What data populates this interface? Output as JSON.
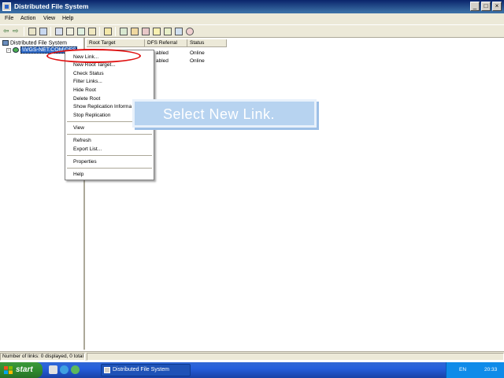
{
  "window": {
    "title": "Distributed File System",
    "min": "_",
    "max": "□",
    "close": "×"
  },
  "menubar": [
    "File",
    "Action",
    "View",
    "Help"
  ],
  "tree": {
    "root_label": "Distributed File System",
    "node_label": "\\\\VGS-NET.COM\\DFS"
  },
  "list": {
    "columns": [
      "Root Target",
      "DFS Referral",
      "Status"
    ],
    "rows": [
      {
        "target": "",
        "referral": "abled",
        "status": "Online"
      },
      {
        "target": "",
        "referral": "abled",
        "status": "Online"
      }
    ]
  },
  "context_menu": {
    "items": [
      "New Link...",
      "New Root Target...",
      "Check Status",
      "Filter Links...",
      "Hide Root",
      "Delete Root",
      "Show Replication Informa",
      "Stop Replication",
      "View",
      "Refresh",
      "Export List...",
      "Properties",
      "Help"
    ]
  },
  "callout": {
    "text": "Select New Link."
  },
  "statusbar": {
    "text": "Number of links: 0 displayed, 0 total"
  },
  "taskbar": {
    "start": "start",
    "task_label": "Distributed File System",
    "lang": "EN",
    "clock": "20:33"
  },
  "colors": {
    "title_bar": "#0a246a",
    "highlight_ring": "#e01010",
    "callout_bg": "#b7d3f0",
    "selection": "#316ac5"
  }
}
